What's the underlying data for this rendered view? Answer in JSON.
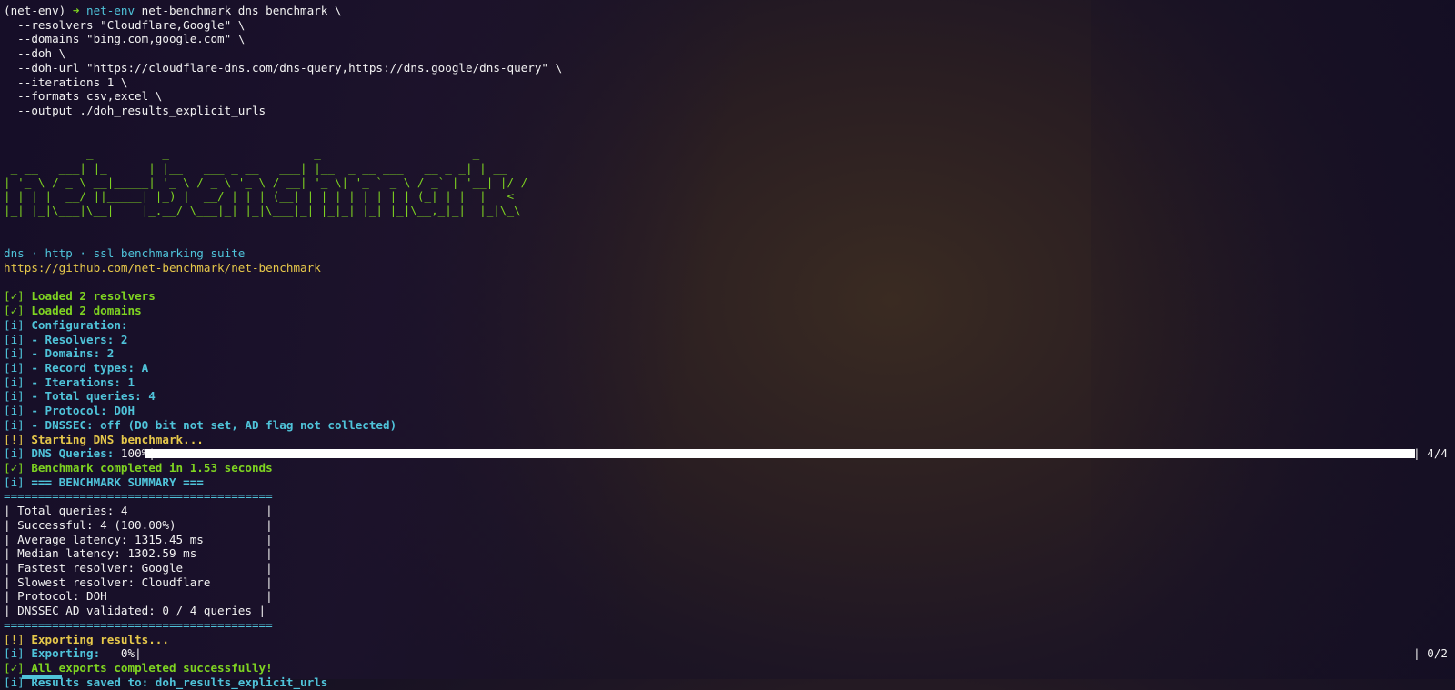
{
  "command": {
    "prompt_env": "(net-env)",
    "arrow": "➜",
    "dir": "net-env",
    "cmd": "net-benchmark dns benchmark \\",
    "args": [
      "  --resolvers \"Cloudflare,Google\" \\",
      "  --domains \"bing.com,google.com\" \\",
      "  --doh \\",
      "  --doh-url \"https://cloudflare-dns.com/dns-query,https://dns.google/dns-query\" \\",
      "  --iterations 1 \\",
      "  --formats csv,excel \\",
      "  --output ./doh_results_explicit_urls"
    ]
  },
  "banner": {
    "ascii": [
      "            _          _                     _                      _      ",
      " _ __   ___| |_      | |__   ___ _ __   ___| |__  _ __ ___   __ _ _| | __",
      "| '_ \\ / _ \\ __|_____| '_ \\ / _ \\ '_ \\ / __| '_ \\| '_ ` _ \\ / _` | '__| |/ /",
      "| | | |  __/ ||_____| |_) |  __/ | | | (__| | | | | | | | | (_| | |  |   < ",
      "|_| |_|\\___|\\__|    |_.__/ \\___|_| |_|\\___|_| |_|_| |_| |_|\\__,_|_|  |_|\\_\\"
    ],
    "tagline": "dns · http · ssl benchmarking suite",
    "url": "https://github.com/net-benchmark/net-benchmark"
  },
  "log": [
    {
      "tag": "[✓]",
      "text": " Loaded 2 resolvers",
      "color": "green"
    },
    {
      "tag": "[✓]",
      "text": " Loaded 2 domains",
      "color": "green"
    },
    {
      "tag": "[i]",
      "text": " Configuration:",
      "color": "cyan"
    },
    {
      "tag": "[i]",
      "text": " - Resolvers: 2",
      "color": "cyan"
    },
    {
      "tag": "[i]",
      "text": " - Domains: 2",
      "color": "cyan"
    },
    {
      "tag": "[i]",
      "text": " - Record types: A",
      "color": "cyan"
    },
    {
      "tag": "[i]",
      "text": " - Iterations: 1",
      "color": "cyan"
    },
    {
      "tag": "[i]",
      "text": " - Total queries: 4",
      "color": "cyan"
    },
    {
      "tag": "[i]",
      "text": " - Protocol: DOH",
      "color": "cyan"
    },
    {
      "tag": "[i]",
      "text": " - DNSSEC: off (DO bit not set, AD flag not collected)",
      "color": "cyan"
    },
    {
      "tag": "[!]",
      "text": " Starting DNS benchmark...",
      "color": "yellow"
    }
  ],
  "dns_progress": {
    "tag": "[i]",
    "label": " DNS Queries: ",
    "percent_text": "100%|",
    "percent": 100,
    "count": "| 4/4"
  },
  "after_progress": [
    {
      "tag": "[✓]",
      "text": " Benchmark completed in 1.53 seconds",
      "color": "green"
    },
    {
      "tag": "[i]",
      "text": " === BENCHMARK SUMMARY ===",
      "color": "cyan"
    }
  ],
  "summary": {
    "border": "=======================================",
    "rows": [
      "| Total queries: 4                    |",
      "| Successful: 4 (100.00%)             |",
      "| Average latency: 1315.45 ms         |",
      "| Median latency: 1302.59 ms          |",
      "| Fastest resolver: Google            |",
      "| Slowest resolver: Cloudflare        |",
      "| Protocol: DOH                       |",
      "| DNSSEC AD validated: 0 / 4 queries |"
    ]
  },
  "export": [
    {
      "tag": "[!]",
      "text": " Exporting results...",
      "color": "yellow"
    }
  ],
  "export_progress": {
    "tag": "[i]",
    "label": " Exporting:   ",
    "percent_text": "0%|",
    "percent": 0,
    "count": "| 0/2"
  },
  "final": [
    {
      "tag": "[✓]",
      "text": " All exports completed successfully!",
      "color": "green"
    },
    {
      "tag": "[i]",
      "text": " Results saved to: doh_results_explicit_urls",
      "color": "cyan"
    }
  ]
}
